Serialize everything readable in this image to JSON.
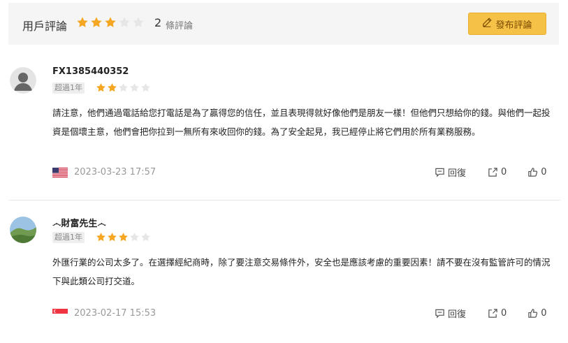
{
  "header": {
    "title": "用戶評論",
    "rating": 3,
    "max_rating": 5,
    "count": "2",
    "count_unit": "條評論",
    "post_button_label": "發布評論"
  },
  "colors": {
    "star_filled": "#f5a623",
    "star_empty": "#e6e6e6",
    "button_bg": "#f5c146"
  },
  "reviews": [
    {
      "username": "FX1385440352",
      "tenure": "超過1年",
      "rating": 2,
      "content": "請注意，他們通過電話給您打電話是為了贏得您的信任，並且表現得就好像他們是朋友一樣！但他們只想給你的錢。與他們一起投資是個壞主意，他們會把你拉到一無所有來收回你的錢。為了安全起見，我已經停止將它們用於所有業務服務。",
      "flag": "us-flag",
      "date": "2023-03-23 17:57",
      "reply_label": "回復",
      "share_count": "0",
      "like_count": "0"
    },
    {
      "username": "෴財富先生෴",
      "tenure": "超過1年",
      "rating": 3,
      "content": "外匯行業的公司太多了。在選擇經紀商時，除了要注意交易條件外，安全也是應該考慮的重要因素！請不要在沒有監管許可的情況下與此類公司打交道。",
      "flag": "sg-flag",
      "date": "2023-02-17 15:53",
      "reply_label": "回復",
      "share_count": "0",
      "like_count": "0"
    }
  ]
}
